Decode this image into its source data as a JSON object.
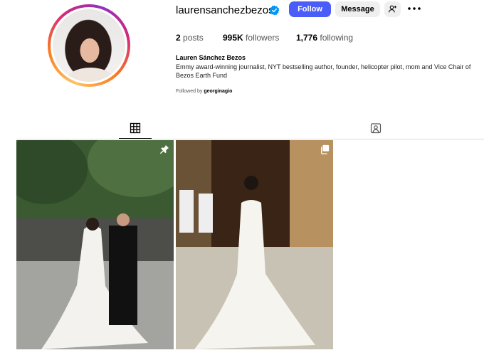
{
  "profile": {
    "username": "laurensanchezbezos",
    "full_name": "Lauren Sánchez Bezos",
    "bio": "Emmy award-winning journalist, NYT bestselling author, founder, helicopter pilot, mom and Vice Chair of Bezos Earth Fund",
    "followed_by_prefix": "Followed by",
    "followed_by_user": "georginagio",
    "verified": true
  },
  "actions": {
    "follow_label": "Follow",
    "message_label": "Message"
  },
  "stats": {
    "posts_count": "2",
    "posts_label": "posts",
    "followers_count": "995K",
    "followers_label": "followers",
    "following_count": "1,776",
    "following_label": "following"
  },
  "tabs": [
    {
      "icon": "grid-icon",
      "active": true
    },
    {
      "icon": "tagged-icon",
      "active": false
    }
  ],
  "posts": [
    {
      "icon": "pin-icon",
      "pinned": true
    },
    {
      "icon": "carousel-icon",
      "pinned": false
    }
  ],
  "colors": {
    "follow_button": "#4a5df9",
    "verified_badge": "#0095f6",
    "secondary_button": "#efefef"
  }
}
